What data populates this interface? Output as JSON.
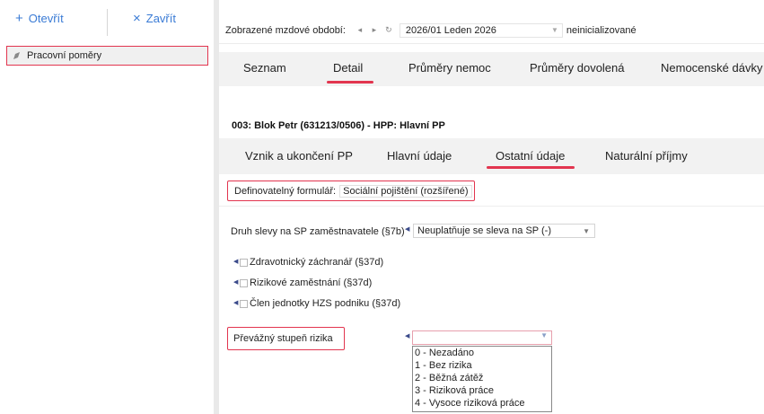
{
  "toolbar": {
    "open_label": "Otevřít",
    "close_label": "Zavřít",
    "open_glyph": "+",
    "close_glyph": "×"
  },
  "sidebar": {
    "items": [
      {
        "label": "Pracovní poměry",
        "icon": "pencil-icon"
      }
    ]
  },
  "period": {
    "label": "Zobrazené mzdové období:",
    "value": "2026/01 Leden 2026",
    "status": "neinicializované",
    "nav_prev": "◂",
    "nav_next": "▸",
    "refresh": "↻"
  },
  "main_tabs": {
    "items": [
      "Seznam",
      "Detail",
      "Průměry nemoc",
      "Průměry dovolená",
      "Nemocenské dávky"
    ],
    "selected": "Detail"
  },
  "employee": {
    "header": "003: Blok Petr (631213/0506) - HPP: Hlavní PP"
  },
  "sub_tabs": {
    "items": [
      "Vznik a ukončení PP",
      "Hlavní údaje",
      "Ostatní údaje",
      "Naturální příjmy"
    ],
    "selected": "Ostatní údaje"
  },
  "form": {
    "definable_label": "Definovatelný formulář:",
    "definable_value": "Sociální pojištění (rozšířené)",
    "discount_label": "Druh slevy na SP zaměstnavatele (§7b)",
    "discount_value": "Neuplatňuje se sleva na SP (-)",
    "checkboxes": [
      {
        "label": "Zdravotnický záchranář (§37d)",
        "checked": false
      },
      {
        "label": "Rizikové zaměstnání (§37d)",
        "checked": false
      },
      {
        "label": "Člen jednotky HZS podniku (§37d)",
        "checked": false
      }
    ],
    "risk_label": "Převážný stupeň rizika",
    "risk_value": "",
    "risk_options": [
      "0 - Nezadáno",
      "1 - Bez rizika",
      "2 - Běžná zátěž",
      "3 - Riziková práce",
      "4 - Vysoce riziková práce"
    ]
  },
  "colors": {
    "accent": "#e2354f",
    "link": "#3a7bd5",
    "tab_bg": "#f2f2f2"
  }
}
